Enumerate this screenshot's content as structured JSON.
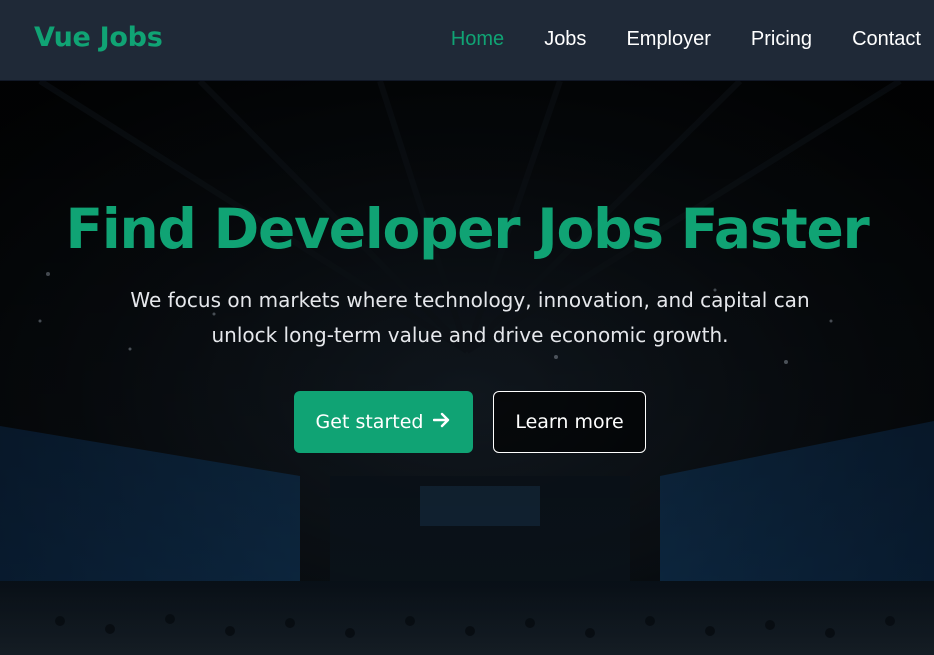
{
  "brand": {
    "logo": "Vue Jobs",
    "accent": "#10a374"
  },
  "nav": {
    "items": [
      {
        "label": "Home",
        "active": true
      },
      {
        "label": "Jobs",
        "active": false
      },
      {
        "label": "Employer",
        "active": false
      },
      {
        "label": "Pricing",
        "active": false
      },
      {
        "label": "Contact",
        "active": false
      }
    ]
  },
  "hero": {
    "title": "Find Developer Jobs Faster",
    "subtitle": "We focus on markets where technology, innovation, and capital can unlock long-term value and drive economic growth.",
    "primary_button": "Get started",
    "primary_icon": "arrow-right-icon",
    "secondary_button": "Learn more",
    "background": "conference-hall-photo"
  }
}
